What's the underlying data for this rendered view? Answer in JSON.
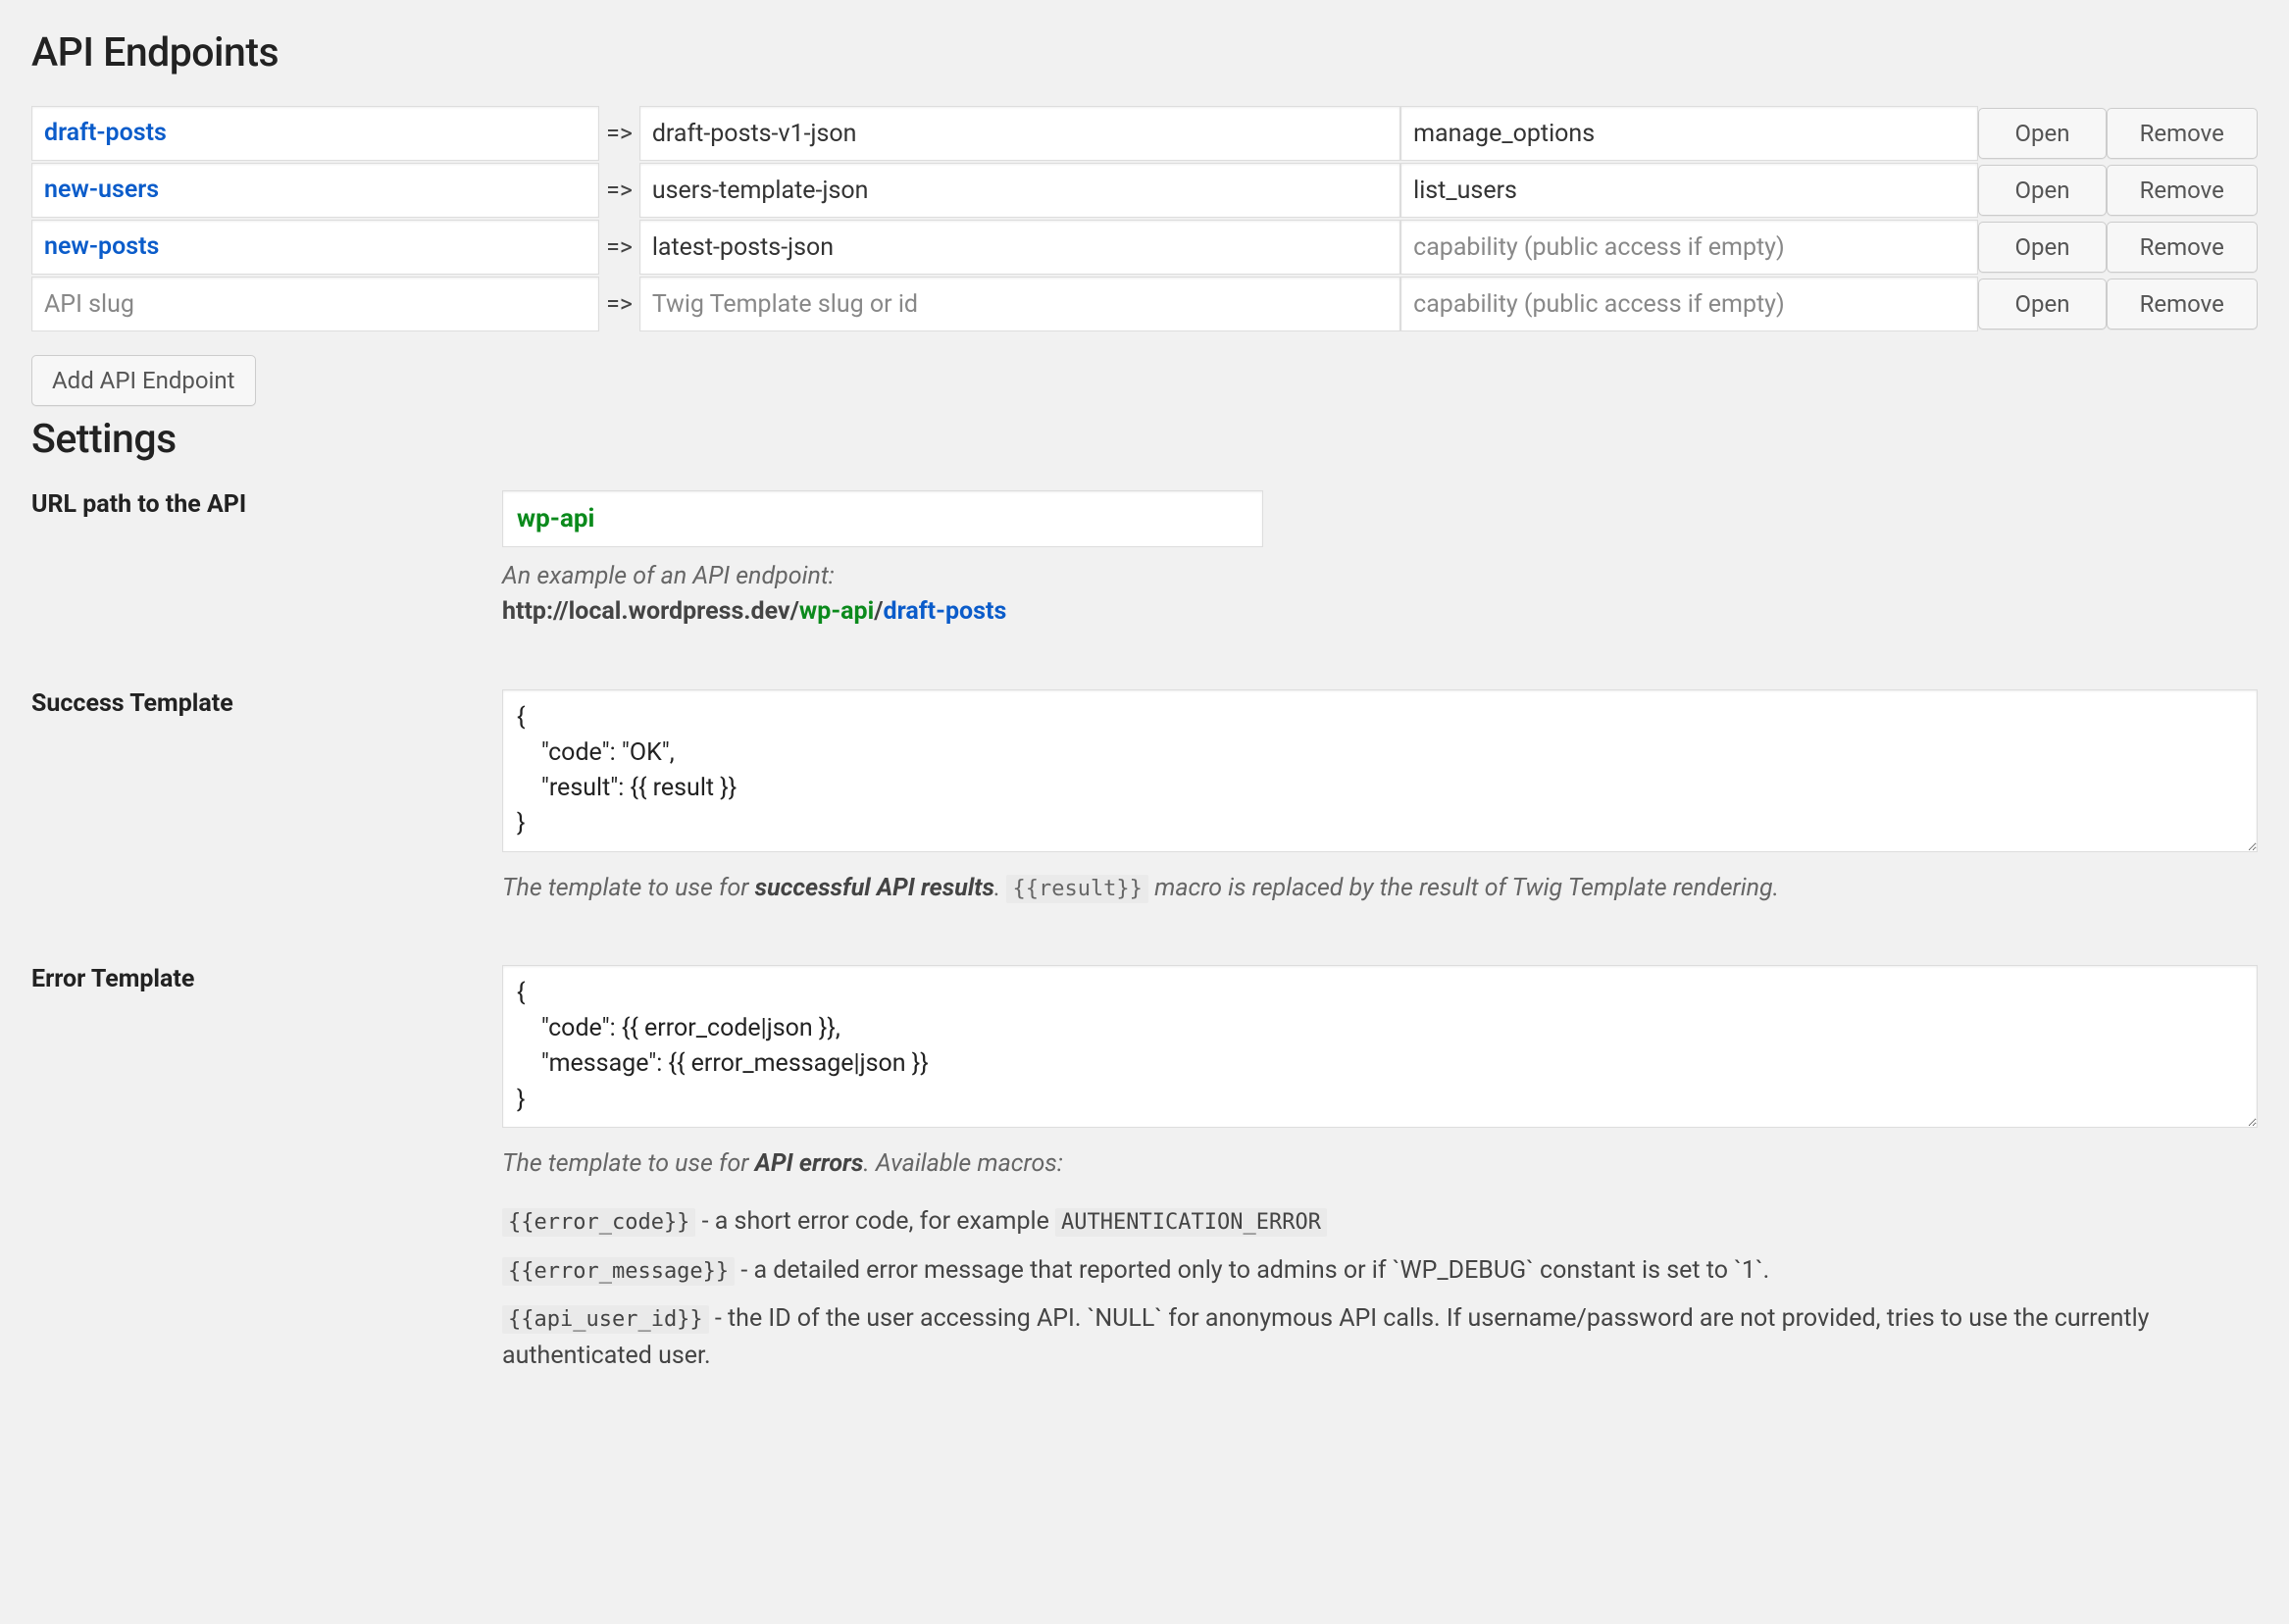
{
  "headings": {
    "endpoints": "API Endpoints",
    "settings": "Settings"
  },
  "endpoints": {
    "arrow": "=>",
    "slug_placeholder": "API slug",
    "template_placeholder": "Twig Template slug or id",
    "capability_placeholder": "capability (public access if empty)",
    "open_label": "Open",
    "remove_label": "Remove",
    "add_label": "Add API Endpoint",
    "rows": [
      {
        "slug": "draft-posts",
        "template": "draft-posts-v1-json",
        "capability": "manage_options"
      },
      {
        "slug": "new-users",
        "template": "users-template-json",
        "capability": "list_users"
      },
      {
        "slug": "new-posts",
        "template": "latest-posts-json",
        "capability": ""
      }
    ]
  },
  "settings": {
    "url_path": {
      "label": "URL path to the API",
      "value": "wp-api",
      "example_intro": "An example of an API endpoint:",
      "example_host": "http://local.wordpress.dev/",
      "example_path": "wp-api",
      "example_sep": "/",
      "example_slug": "draft-posts"
    },
    "success_template": {
      "label": "Success Template",
      "value": "{\n    \"code\": \"OK\",\n    \"result\": {{ result }}\n}",
      "desc_before": "The template to use for ",
      "desc_bold": "successful API results",
      "desc_period": ".",
      "macro": "{{result}}",
      "desc_after": " macro is replaced by the result of Twig Template rendering."
    },
    "error_template": {
      "label": "Error Template",
      "value": "{\n    \"code\": {{ error_code|json }},\n    \"message\": {{ error_message|json }}\n}",
      "desc_before": "The template to use for ",
      "desc_bold": "API errors",
      "desc_after": ". Available macros:",
      "macros": [
        {
          "code": "{{error_code}}",
          "text": " - a short error code, for example ",
          "code2": "AUTHENTICATION_ERROR",
          "tail": ""
        },
        {
          "code": "{{error_message}}",
          "text": " - a detailed error message that reported only to admins or if `WP_DEBUG` constant is set to `1`.",
          "code2": "",
          "tail": ""
        },
        {
          "code": "{{api_user_id}}",
          "text": " - the ID of the user accessing API. `NULL` for anonymous API calls. If username/password are not provided, tries to use the currently authenticated user.",
          "code2": "",
          "tail": ""
        }
      ]
    }
  }
}
